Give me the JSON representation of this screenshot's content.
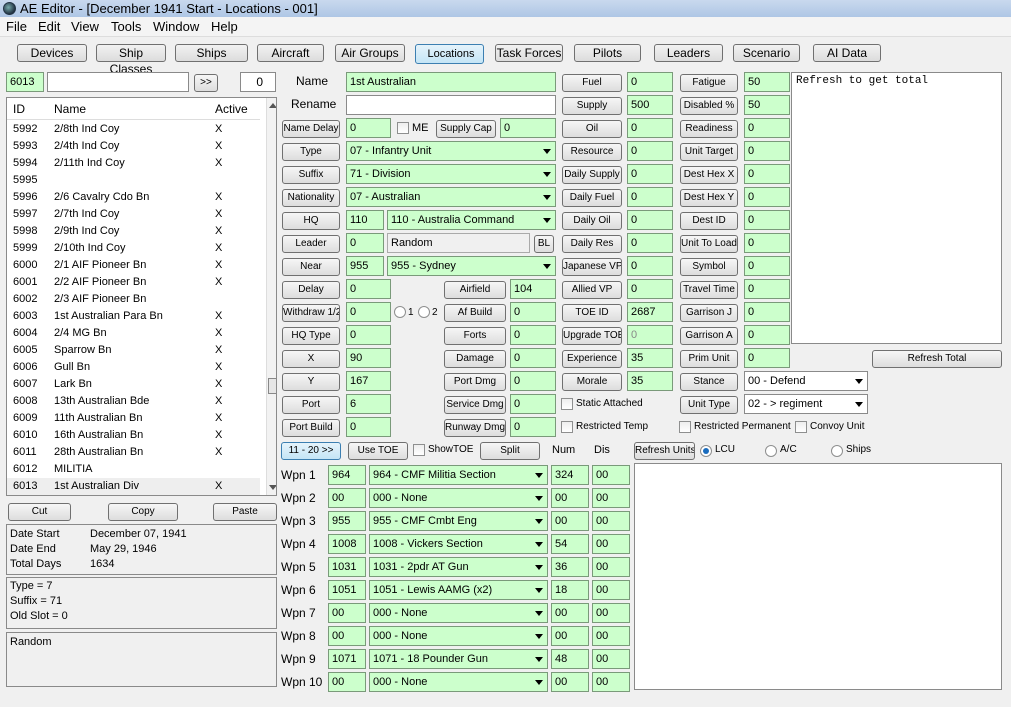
{
  "window": {
    "title": "AE Editor - [December 1941 Start - Locations - 001]"
  },
  "menu": [
    "File",
    "Edit",
    "View",
    "Tools",
    "Window",
    "Help"
  ],
  "nav": [
    "Devices",
    "Ship Classes",
    "Ships",
    "Aircraft",
    "Air Groups",
    "Locations",
    "Task Forces",
    "Pilots",
    "Leaders",
    "Scenario",
    "AI Data"
  ],
  "search": {
    "id_value": "6013",
    "text_value": "",
    "go_label": ">>",
    "count_value": "0"
  },
  "list": {
    "headers": {
      "id": "ID",
      "name": "Name",
      "active": "Active"
    },
    "rows": [
      {
        "id": "5992",
        "name": "2/8th Ind Coy",
        "active": "X"
      },
      {
        "id": "5993",
        "name": "2/4th Ind Coy",
        "active": "X"
      },
      {
        "id": "5994",
        "name": "2/11th Ind Coy",
        "active": "X"
      },
      {
        "id": "5995",
        "name": "",
        "active": ""
      },
      {
        "id": "5996",
        "name": "2/6 Cavalry Cdo Bn",
        "active": "X"
      },
      {
        "id": "5997",
        "name": "2/7th Ind Coy",
        "active": "X"
      },
      {
        "id": "5998",
        "name": "2/9th Ind Coy",
        "active": "X"
      },
      {
        "id": "5999",
        "name": "2/10th Ind Coy",
        "active": "X"
      },
      {
        "id": "6000",
        "name": "2/1 AIF Pioneer Bn",
        "active": "X"
      },
      {
        "id": "6001",
        "name": "2/2 AIF Pioneer Bn",
        "active": "X"
      },
      {
        "id": "6002",
        "name": "2/3 AIF Pioneer Bn",
        "active": ""
      },
      {
        "id": "6003",
        "name": "1st Australian Para Bn",
        "active": "X"
      },
      {
        "id": "6004",
        "name": "2/4 MG Bn",
        "active": "X"
      },
      {
        "id": "6005",
        "name": "Sparrow Bn",
        "active": "X"
      },
      {
        "id": "6006",
        "name": "Gull Bn",
        "active": "X"
      },
      {
        "id": "6007",
        "name": "Lark Bn",
        "active": "X"
      },
      {
        "id": "6008",
        "name": "13th Australian Bde",
        "active": "X"
      },
      {
        "id": "6009",
        "name": "11th Australian Bn",
        "active": "X"
      },
      {
        "id": "6010",
        "name": "16th Australian Bn",
        "active": "X"
      },
      {
        "id": "6011",
        "name": "28th Australian Bn",
        "active": "X"
      },
      {
        "id": "6012",
        "name": "MILITIA",
        "active": ""
      },
      {
        "id": "6013",
        "name": "1st Australian Div",
        "active": "X"
      }
    ]
  },
  "clipboard": {
    "cut": "Cut",
    "copy": "Copy",
    "paste": "Paste"
  },
  "dates": {
    "start_label": "Date Start",
    "start_value": "December 07, 1941",
    "end_label": "Date End",
    "end_value": "May 29, 1946",
    "days_label": "Total Days",
    "days_value": "1634"
  },
  "info": [
    "Type = 7",
    "Suffix = 71",
    "Old Slot = 0"
  ],
  "leader_box": "Random",
  "form": {
    "name_label": "Name",
    "name_value": "1st Australian",
    "rename_label": "Rename",
    "rename_value": "",
    "name_delay_label": "Name Delay",
    "name_delay_value": "0",
    "me_label": "ME",
    "supply_cap_label": "Supply Cap",
    "supply_cap_value": "0",
    "type_label": "Type",
    "type_value": "07 - Infantry Unit",
    "suffix_label": "Suffix",
    "suffix_value": "71 - Division",
    "nationality_label": "Nationality",
    "nationality_value": "07 - Australian",
    "hq_label": "HQ",
    "hq_num": "110",
    "hq_value": "110 - Australia Command",
    "leader_label": "Leader",
    "leader_num": "0",
    "leader_value": "Random",
    "bl_label": "BL",
    "near_label": "Near",
    "near_num": "955",
    "near_value": "955 - Sydney",
    "delay_label": "Delay",
    "delay_value": "0",
    "airfield_label": "Airfield",
    "airfield_value": "104",
    "withdraw_label": "Withdraw 1/2",
    "withdraw_value": "0",
    "opt1": "1",
    "opt2": "2",
    "af_build_label": "Af Build",
    "af_build_value": "0",
    "hq_type_label": "HQ Type",
    "hq_type_value": "0",
    "forts_label": "Forts",
    "forts_value": "0",
    "x_label": "X",
    "x_value": "90",
    "damage_label": "Damage",
    "damage_value": "0",
    "y_label": "Y",
    "y_value": "167",
    "port_dmg_label": "Port Dmg",
    "port_dmg_value": "0",
    "port_label": "Port",
    "port_value": "6",
    "service_dmg_label": "Service Dmg",
    "service_dmg_value": "0",
    "port_build_label": "Port Build",
    "port_build_value": "0",
    "runway_dmg_label": "Runway Dmg",
    "runway_dmg_value": "0"
  },
  "col3": [
    {
      "label": "Fuel",
      "value": "0"
    },
    {
      "label": "Supply",
      "value": "500"
    },
    {
      "label": "Oil",
      "value": "0"
    },
    {
      "label": "Resource",
      "value": "0"
    },
    {
      "label": "Daily Supply",
      "value": "0"
    },
    {
      "label": "Daily Fuel",
      "value": "0"
    },
    {
      "label": "Daily Oil",
      "value": "0"
    },
    {
      "label": "Daily Res",
      "value": "0"
    },
    {
      "label": "Japanese VP",
      "value": "0"
    },
    {
      "label": "Allied VP",
      "value": "0"
    },
    {
      "label": "TOE ID",
      "value": "2687"
    },
    {
      "label": "Upgrade TOE",
      "value": "0"
    },
    {
      "label": "Experience",
      "value": "35"
    },
    {
      "label": "Morale",
      "value": "35"
    }
  ],
  "col4": [
    {
      "label": "Fatigue",
      "value": "50"
    },
    {
      "label": "Disabled %",
      "value": "50"
    },
    {
      "label": "Readiness",
      "value": "0"
    },
    {
      "label": "Unit Target",
      "value": "0"
    },
    {
      "label": "Dest Hex X",
      "value": "0"
    },
    {
      "label": "Dest Hex Y",
      "value": "0"
    },
    {
      "label": "Dest ID",
      "value": "0"
    },
    {
      "label": "Unit To Load",
      "value": "0"
    },
    {
      "label": "Symbol",
      "value": "0"
    },
    {
      "label": "Travel Time",
      "value": "0"
    },
    {
      "label": "Garrison J",
      "value": "0"
    },
    {
      "label": "Garrison A",
      "value": "0"
    },
    {
      "label": "Prim Unit",
      "value": "0"
    }
  ],
  "stance": {
    "label": "Stance",
    "value": "00 - Defend"
  },
  "unit_type": {
    "label": "Unit Type",
    "value": "02 - > regiment"
  },
  "checks": {
    "static": "Static Attached",
    "rtemp": "Restricted Temp",
    "rperm": "Restricted Permanent",
    "convoy": "Convoy Unit"
  },
  "notes_text": "Refresh to get total",
  "refresh_total": "Refresh Total",
  "controls": {
    "range": "11 - 20 >>",
    "use_toe": "Use TOE",
    "show_toe": "ShowTOE",
    "split": "Split",
    "num": "Num",
    "dis": "Dis",
    "refresh_units": "Refresh Units",
    "lcu": "LCU",
    "ac": "A/C",
    "ships": "Ships"
  },
  "weapons": [
    {
      "label": "Wpn 1",
      "id": "964",
      "name": "964 - CMF Militia Section",
      "num": "324",
      "dis": "00"
    },
    {
      "label": "Wpn 2",
      "id": "00",
      "name": "000 - None",
      "num": "00",
      "dis": "00"
    },
    {
      "label": "Wpn 3",
      "id": "955",
      "name": "955 - CMF Cmbt Eng",
      "num": "00",
      "dis": "00"
    },
    {
      "label": "Wpn 4",
      "id": "1008",
      "name": "1008 - Vickers Section",
      "num": "54",
      "dis": "00"
    },
    {
      "label": "Wpn 5",
      "id": "1031",
      "name": "1031 - 2pdr AT Gun",
      "num": "36",
      "dis": "00"
    },
    {
      "label": "Wpn 6",
      "id": "1051",
      "name": "1051 - Lewis AAMG (x2)",
      "num": "18",
      "dis": "00"
    },
    {
      "label": "Wpn 7",
      "id": "00",
      "name": "000 - None",
      "num": "00",
      "dis": "00"
    },
    {
      "label": "Wpn 8",
      "id": "00",
      "name": "000 - None",
      "num": "00",
      "dis": "00"
    },
    {
      "label": "Wpn 9",
      "id": "1071",
      "name": "1071 - 18 Pounder Gun",
      "num": "48",
      "dis": "00"
    },
    {
      "label": "Wpn 10",
      "id": "00",
      "name": "000 - None",
      "num": "00",
      "dis": "00"
    }
  ]
}
